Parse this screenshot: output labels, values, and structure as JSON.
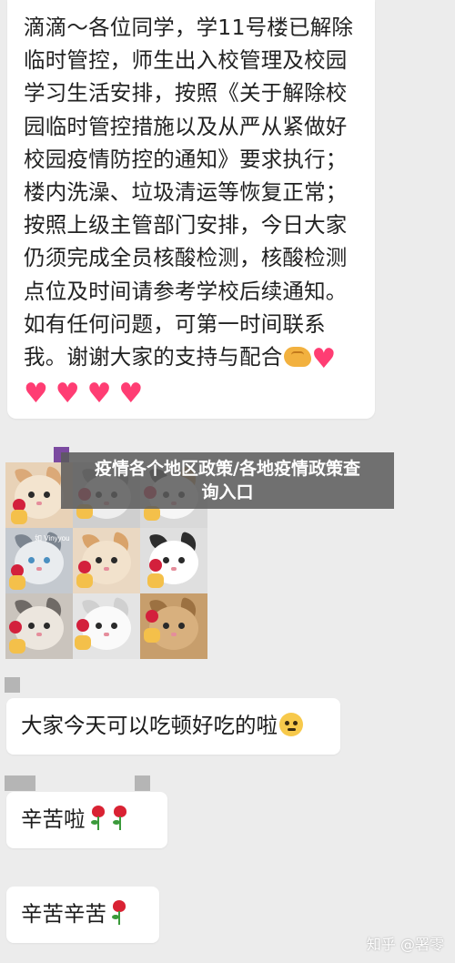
{
  "message1": {
    "lines": [
      "滴滴～各位同学，学11号楼已解除",
      "临时管控，师生出入校管理及校园",
      "学习生活安排，按照《关于解除校",
      "园临时管控措施以及从严从紧做好",
      "校园疫情防控的通知》要求执行；",
      "楼内洗澡、垃圾清运等恢复正常；",
      "按照上级主管部门安排，今日大家",
      "仍须完成全员核酸检测，核酸检测",
      "点位及时间请参考学校后续通知。",
      "如有任何问题，可第一时间联系",
      "我。谢谢大家的支持与配合"
    ],
    "heart_glyph": "♥"
  },
  "banner": {
    "line1": "疫情各个地区政策/各地疫情政策查",
    "line2": "询入口"
  },
  "sticker_grid": {
    "top_middle_caption": "如 Vinyyou"
  },
  "message2": {
    "text": "大家今天可以吃顿好吃的啦"
  },
  "message3": {
    "text": "辛苦啦"
  },
  "message4": {
    "text": "辛苦辛苦"
  },
  "watermark": {
    "text": "知乎 @署零"
  },
  "colors": {
    "background": "#ececec",
    "bubble": "#ffffff",
    "heart": "#ff3d73",
    "banner": "#5a5a5a"
  }
}
